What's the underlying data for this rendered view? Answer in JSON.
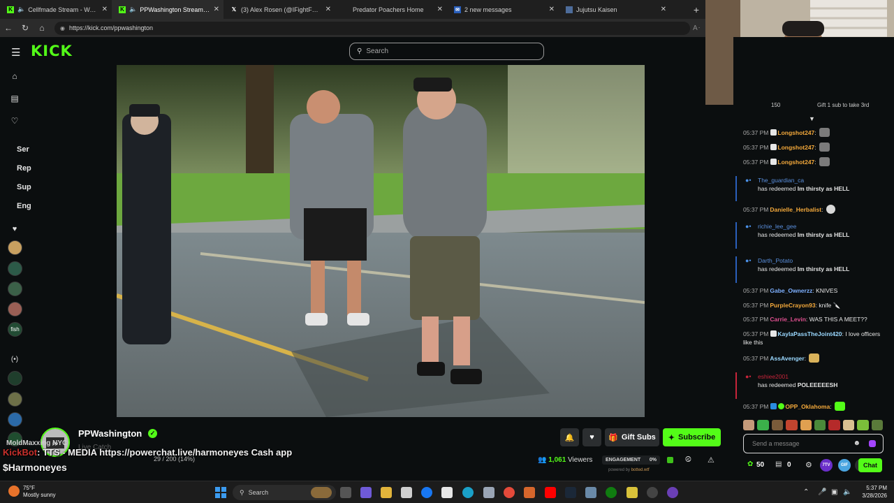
{
  "browser": {
    "tabs": [
      {
        "label": "Cellfmade Stream - Watch Live",
        "icon": "kick-icon",
        "audio": true,
        "active": false
      },
      {
        "label": "PPWashington Stream - Watch Live",
        "icon": "kick-icon",
        "audio": true,
        "active": true
      },
      {
        "label": "(3) Alex Rosen (@IFightForKids) / X",
        "icon": "x-icon",
        "audio": false,
        "active": false
      },
      {
        "label": "Predator Poachers Home",
        "icon": "page-icon",
        "audio": false,
        "active": false
      },
      {
        "label": "2 new messages",
        "icon": "mail-icon",
        "audio": false,
        "active": false
      },
      {
        "label": "Jujutsu Kaisen",
        "icon": "page-icon",
        "audio": false,
        "active": false
      }
    ],
    "url": "https://kick.com/ppwashington"
  },
  "kick": {
    "logo": "KICK",
    "search_placeholder": "Search"
  },
  "sidebar": {
    "sections": [
      "Ser",
      "Rep",
      "Sup",
      "Eng"
    ],
    "following_avatars": 5,
    "recommended_avatars": 4
  },
  "stream": {
    "streamer": "PPWashington",
    "category": "Live Catch",
    "overlay_user": "MoldMaxxing NYC",
    "overlay_bot": "KickBot",
    "overlay_tts": ": TTS - MEDIA https://powerchat.live/harmoneyes Cash app",
    "overlay_progress": "29 / 200 (14%)",
    "overlay_handle": "$Harmoneyes",
    "gift_label": "Gift Subs",
    "subscribe_label": "Subscribe",
    "viewers_count": "1,061",
    "viewers_label": "Viewers",
    "engagement_label": "ENGAGEMENT",
    "engagement_value": "0%",
    "powered_by": "powered by",
    "powered_site": "botted.wtf"
  },
  "chat": {
    "top_strip_left": "150",
    "top_strip_right": "Gift 1 sub to take 3rd",
    "messages": [
      {
        "type": "msg",
        "time": "05:37 PM",
        "user": "Longshot247",
        "color": "#f4a93b",
        "text": ""
      },
      {
        "type": "msg",
        "time": "05:37 PM",
        "user": "Longshot247",
        "color": "#f4a93b",
        "text": ""
      },
      {
        "type": "msg",
        "time": "05:37 PM",
        "user": "Longshot247",
        "color": "#f4a93b",
        "text": ""
      },
      {
        "type": "redeem",
        "user": "The_guardian_ca",
        "action": "has redeemed",
        "reward": "Im thirsty as HELL",
        "color": "#2a5fbb"
      },
      {
        "type": "msg",
        "time": "05:37 PM",
        "user": "Danielle_Herbalist",
        "color": "#f4a93b",
        "text": ""
      },
      {
        "type": "redeem",
        "user": "richie_lee_gee",
        "action": "has redeemed",
        "reward": "Im thirsty as HELL",
        "color": "#2a5fbb"
      },
      {
        "type": "redeem",
        "user": "Darth_Potato",
        "action": "has redeemed",
        "reward": "Im thirsty as HELL",
        "color": "#2a5fbb"
      },
      {
        "type": "msg",
        "time": "05:37 PM",
        "user": "Gabe_Ownerzz",
        "color": "#7eb0ff",
        "text": "KNIVES"
      },
      {
        "type": "msg",
        "time": "05:37 PM",
        "user": "PurpleCrayon93",
        "color": "#f4a93b",
        "text": "knife"
      },
      {
        "type": "msg",
        "time": "05:37 PM",
        "user": "Carrie_Levin",
        "color": "#e05090",
        "text": "WAS THIS A MEET??"
      },
      {
        "type": "msg",
        "time": "05:37 PM",
        "user": "KaylaPassTheJoint420",
        "color": "#9ad8ff",
        "text": "I love officers like this"
      },
      {
        "type": "msg",
        "time": "05:37 PM",
        "user": "AssAvenger",
        "color": "#9ad8ff",
        "text": ""
      },
      {
        "type": "redeem",
        "user": "eshiee2001",
        "action": "has redeemed",
        "reward": "POLEEEEESH",
        "color": "#c7243a"
      },
      {
        "type": "msg",
        "time": "05:37 PM",
        "user": "OPP_Oklahoma",
        "color": "#f4a93b",
        "text": ""
      }
    ],
    "input_placeholder": "Send a message",
    "points": "50",
    "gifts": "0",
    "chat_button": "Chat"
  },
  "taskbar": {
    "temp": "75°F",
    "weather": "Mostly sunny",
    "search_placeholder": "Search",
    "time": "5:37 PM",
    "date": "3/28/2026"
  },
  "colors": {
    "kick_green": "#53fc18",
    "page_bg": "#0b0e0f",
    "button_bg": "#2b2e30"
  }
}
